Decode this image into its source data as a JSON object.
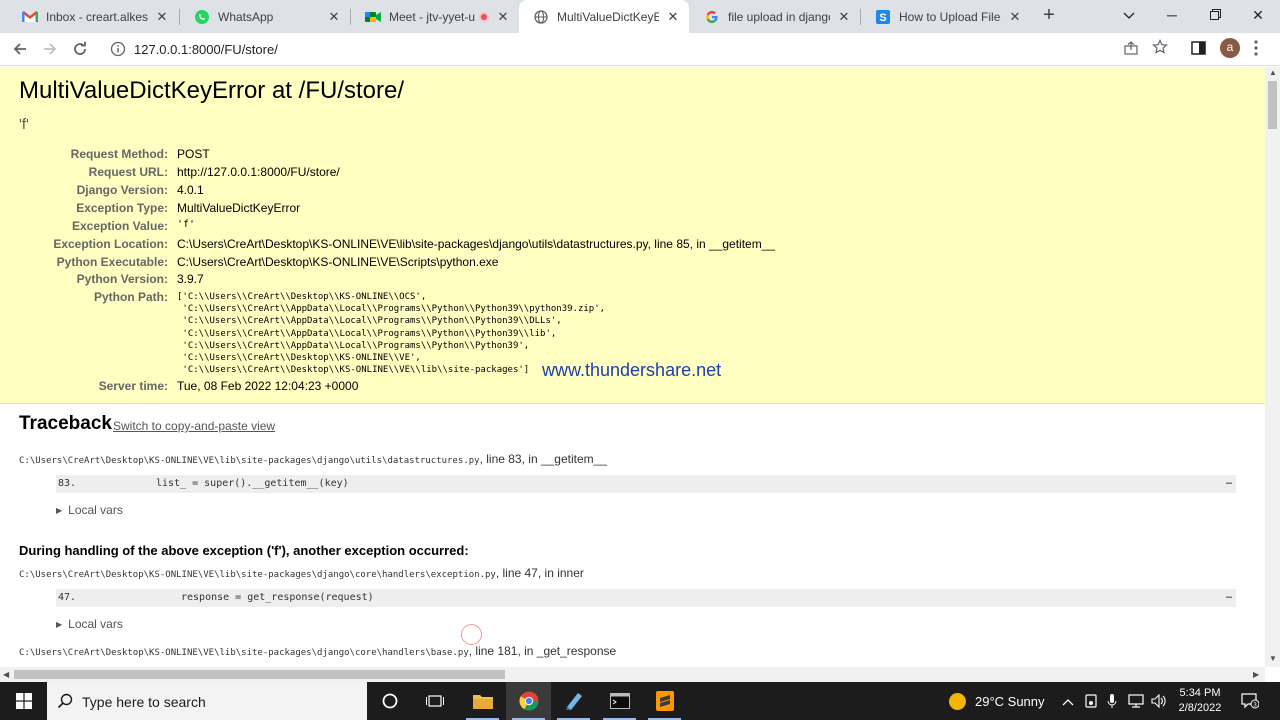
{
  "browser": {
    "tabs": [
      {
        "title": "Inbox - creart.alkesh@",
        "icon": "gmail-icon"
      },
      {
        "title": "WhatsApp",
        "icon": "whatsapp-icon"
      },
      {
        "title": "Meet - jtv-yyet-us",
        "icon": "meet-icon"
      },
      {
        "title": "MultiValueDictKeyErro",
        "icon": "globe-icon",
        "active": true
      },
      {
        "title": "file upload in django w",
        "icon": "google-icon"
      },
      {
        "title": "How to Upload Files W",
        "icon": "s-site-icon"
      }
    ],
    "url": "127.0.0.1:8000/FU/store/",
    "avatar_letter": "a"
  },
  "page": {
    "title": "MultiValueDictKeyError at /FU/store/",
    "exception_value_short": "'f'",
    "meta": {
      "request_method": {
        "label": "Request Method:",
        "value": "POST"
      },
      "request_url": {
        "label": "Request URL:",
        "value": "http://127.0.0.1:8000/FU/store/"
      },
      "django_version": {
        "label": "Django Version:",
        "value": "4.0.1"
      },
      "exception_type": {
        "label": "Exception Type:",
        "value": "MultiValueDictKeyError"
      },
      "exception_value": {
        "label": "Exception Value:",
        "value": "'f'"
      },
      "exception_location": {
        "label": "Exception Location:",
        "value": "C:\\Users\\CreArt\\Desktop\\KS-ONLINE\\VE\\lib\\site-packages\\django\\utils\\datastructures.py, line 85, in __getitem__"
      },
      "python_executable": {
        "label": "Python Executable:",
        "value": "C:\\Users\\CreArt\\Desktop\\KS-ONLINE\\VE\\Scripts\\python.exe"
      },
      "python_version": {
        "label": "Python Version:",
        "value": "3.9.7"
      },
      "python_path": {
        "label": "Python Path:",
        "value": "['C:\\\\Users\\\\CreArt\\\\Desktop\\\\KS-ONLINE\\\\OCS',\n 'C:\\\\Users\\\\CreArt\\\\AppData\\\\Local\\\\Programs\\\\Python\\\\Python39\\\\python39.zip',\n 'C:\\\\Users\\\\CreArt\\\\AppData\\\\Local\\\\Programs\\\\Python\\\\Python39\\\\DLLs',\n 'C:\\\\Users\\\\CreArt\\\\AppData\\\\Local\\\\Programs\\\\Python\\\\Python39\\\\lib',\n 'C:\\\\Users\\\\CreArt\\\\AppData\\\\Local\\\\Programs\\\\Python\\\\Python39',\n 'C:\\\\Users\\\\CreArt\\\\Desktop\\\\KS-ONLINE\\\\VE',\n 'C:\\\\Users\\\\CreArt\\\\Desktop\\\\KS-ONLINE\\\\VE\\\\lib\\\\site-packages']"
      },
      "server_time": {
        "label": "Server time:",
        "value": "Tue, 08 Feb 2022 12:04:23 +0000"
      }
    },
    "watermark": "www.thundershare.net",
    "traceback": {
      "heading": "Traceback",
      "switch_link": "Switch to copy-and-paste view",
      "frames": [
        {
          "file": "C:\\Users\\CreArt\\Desktop\\KS-ONLINE\\VE\\lib\\site-packages\\django\\utils\\datastructures.py",
          "loc": ", line 83, in __getitem__",
          "line_no": "83.",
          "code": "list_ = super().__getitem__(key)",
          "ellipsis": "…",
          "local_vars": "Local vars"
        },
        {
          "file": "C:\\Users\\CreArt\\Desktop\\KS-ONLINE\\VE\\lib\\site-packages\\django\\core\\handlers\\exception.py",
          "loc": ", line 47, in inner",
          "line_no": "47.",
          "code": "response = get_response(request)",
          "ellipsis": "…",
          "local_vars": "Local vars"
        },
        {
          "file": "C:\\Users\\CreArt\\Desktop\\KS-ONLINE\\VE\\lib\\site-packages\\django\\core\\handlers\\base.py",
          "loc": ", line 181, in _get_response"
        }
      ],
      "during_handling": "During handling of the above exception ('f'), another exception occurred:"
    }
  },
  "taskbar": {
    "search_placeholder": "Type here to search",
    "weather": "29°C  Sunny",
    "time": "5:34 PM",
    "date": "2/8/2022"
  }
}
